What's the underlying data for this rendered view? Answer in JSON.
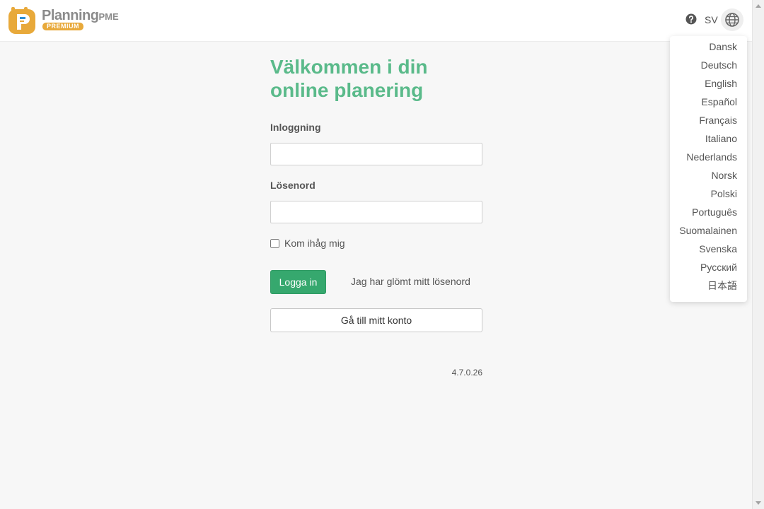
{
  "header": {
    "logo_word": "Planning",
    "logo_word_suffix": "PME",
    "logo_badge": "PREMIUM",
    "language_code": "SV"
  },
  "language_menu": {
    "items": [
      "Dansk",
      "Deutsch",
      "English",
      "Español",
      "Français",
      "Italiano",
      "Nederlands",
      "Norsk",
      "Polski",
      "Português",
      "Suomalainen",
      "Svenska",
      "Русский",
      "日本語"
    ]
  },
  "login": {
    "welcome_line1": "Välkommen i din",
    "welcome_line2": "online planering",
    "username_label": "Inloggning",
    "username_value": "",
    "password_label": "Lösenord",
    "password_value": "",
    "remember_label": "Kom ihåg mig",
    "remember_checked": false,
    "login_button": "Logga in",
    "forgot_link": "Jag har glömt mitt lösenord",
    "account_button": "Gå till mitt konto",
    "version": "4.7.0.26"
  },
  "colors": {
    "accent_green": "#5aba8a",
    "button_green": "#36a86e",
    "logo_orange": "#e8a93a"
  }
}
